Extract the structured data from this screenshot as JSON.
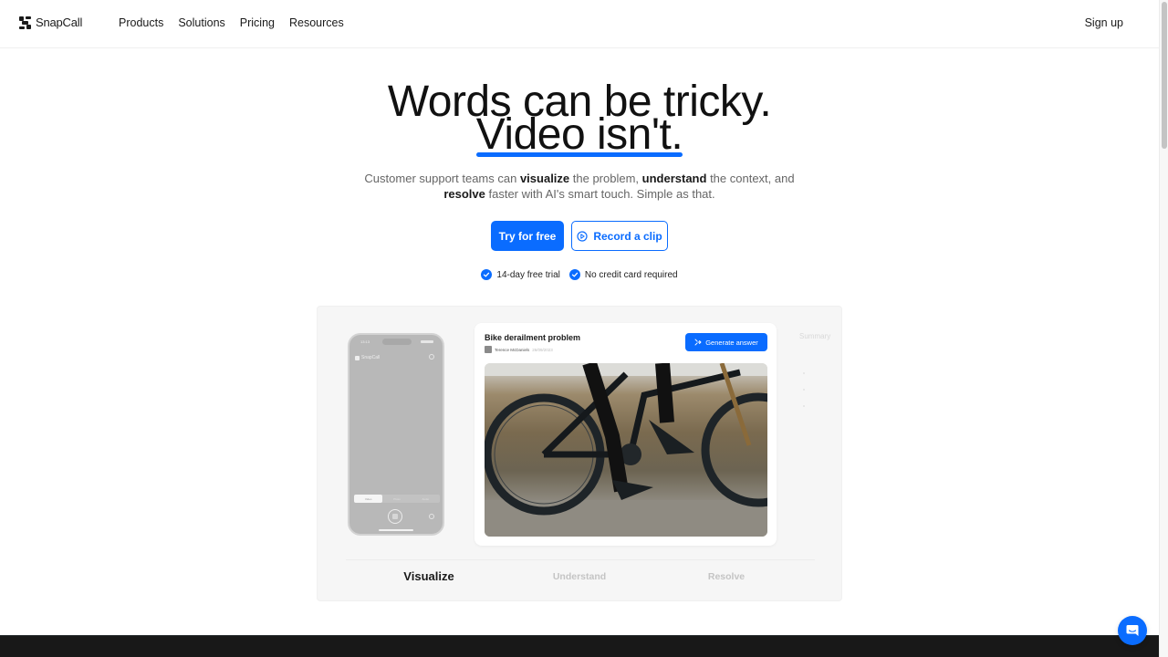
{
  "header": {
    "brand": "SnapCall",
    "nav": [
      "Products",
      "Solutions",
      "Pricing",
      "Resources"
    ],
    "signup": "Sign up"
  },
  "hero": {
    "line1": "Words can be tricky.",
    "line2": "Video isn't.",
    "subtitle": {
      "p1": "Customer support teams can ",
      "b1": "visualize",
      "p2": " the problem, ",
      "b2": "understand",
      "p3": " the context, and",
      "b3": "resolve",
      "p4": " faster with AI's smart touch. Simple as that."
    },
    "primary_cta": "Try for free",
    "secondary_cta": "Record a clip",
    "perks": [
      "14-day free trial",
      "No credit card required"
    ]
  },
  "demo": {
    "phone": {
      "time": "13:13",
      "brand": "SnapCall",
      "tabs": [
        "Video",
        "Photo",
        "Audio"
      ]
    },
    "ticket": {
      "title": "Bike derailment problem",
      "author": "Terence McDaniels",
      "date": "26/09/2023",
      "generate_label": "Generate answer"
    },
    "summary_label": "Summary",
    "tabs": [
      {
        "label": "Visualize",
        "active": true
      },
      {
        "label": "Understand",
        "active": false
      },
      {
        "label": "Resolve",
        "active": false
      }
    ]
  },
  "icons": {
    "logo": "snapcall-logo-icon",
    "record": "play-circle-icon",
    "perk": "check-circle-icon",
    "generate": "sparkle-icon",
    "chat": "chat-bubble-icon"
  },
  "colors": {
    "accent": "#0a6cff",
    "text": "#1a1a1a",
    "muted": "#666666",
    "footer": "#181818"
  }
}
